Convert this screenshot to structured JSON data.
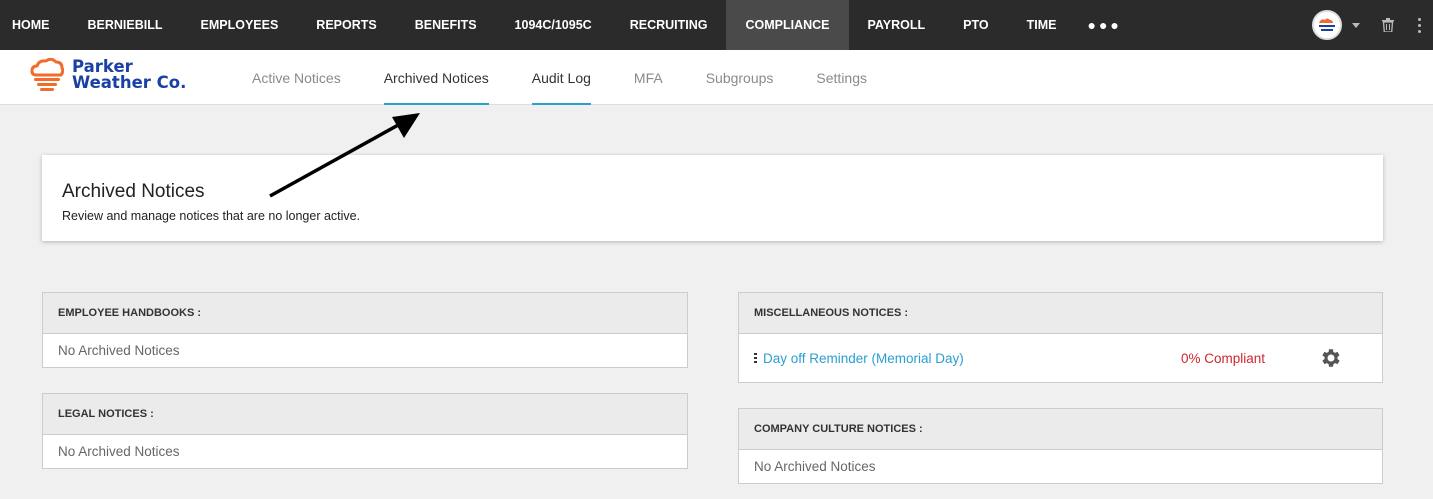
{
  "topnav": {
    "items": [
      "HOME",
      "BERNIEBILL",
      "EMPLOYEES",
      "REPORTS",
      "BENEFITS",
      "1094C/1095C",
      "RECRUITING",
      "COMPLIANCE",
      "PAYROLL",
      "PTO",
      "TIME"
    ],
    "active": "COMPLIANCE",
    "more_icon": "ellipsis-icon",
    "right_icons": [
      "avatar",
      "chevron-down-icon",
      "trash-icon",
      "kebab-icon"
    ]
  },
  "brand": {
    "line1": "Parker",
    "line2": "Weather Co.",
    "icon": "cloud-logo-icon",
    "color": "#1a3fa6",
    "accent": "#f26b2a"
  },
  "tabs": [
    {
      "label": "Active Notices"
    },
    {
      "label": "Archived Notices",
      "selected": true
    },
    {
      "label": "Audit Log",
      "selected": true
    },
    {
      "label": "MFA"
    },
    {
      "label": "Subgroups"
    },
    {
      "label": "Settings"
    }
  ],
  "header": {
    "title": "Archived Notices",
    "subtitle": "Review and manage notices that are no longer active."
  },
  "panels": {
    "handbooks": {
      "title": "EMPLOYEE HANDBOOKS :",
      "empty": "No Archived Notices"
    },
    "legal": {
      "title": "LEGAL NOTICES :",
      "empty": "No Archived Notices"
    },
    "misc": {
      "title": "MISCELLANEOUS NOTICES :",
      "rows": [
        {
          "name": "Day off Reminder (Memorial Day)",
          "compliance": "0% Compliant"
        }
      ]
    },
    "culture": {
      "title": "COMPANY CULTURE NOTICES :",
      "empty": "No Archived Notices"
    }
  },
  "colors": {
    "link": "#2a9fd0",
    "alert": "#d0272f",
    "nav_bg": "#2b2b2b"
  }
}
